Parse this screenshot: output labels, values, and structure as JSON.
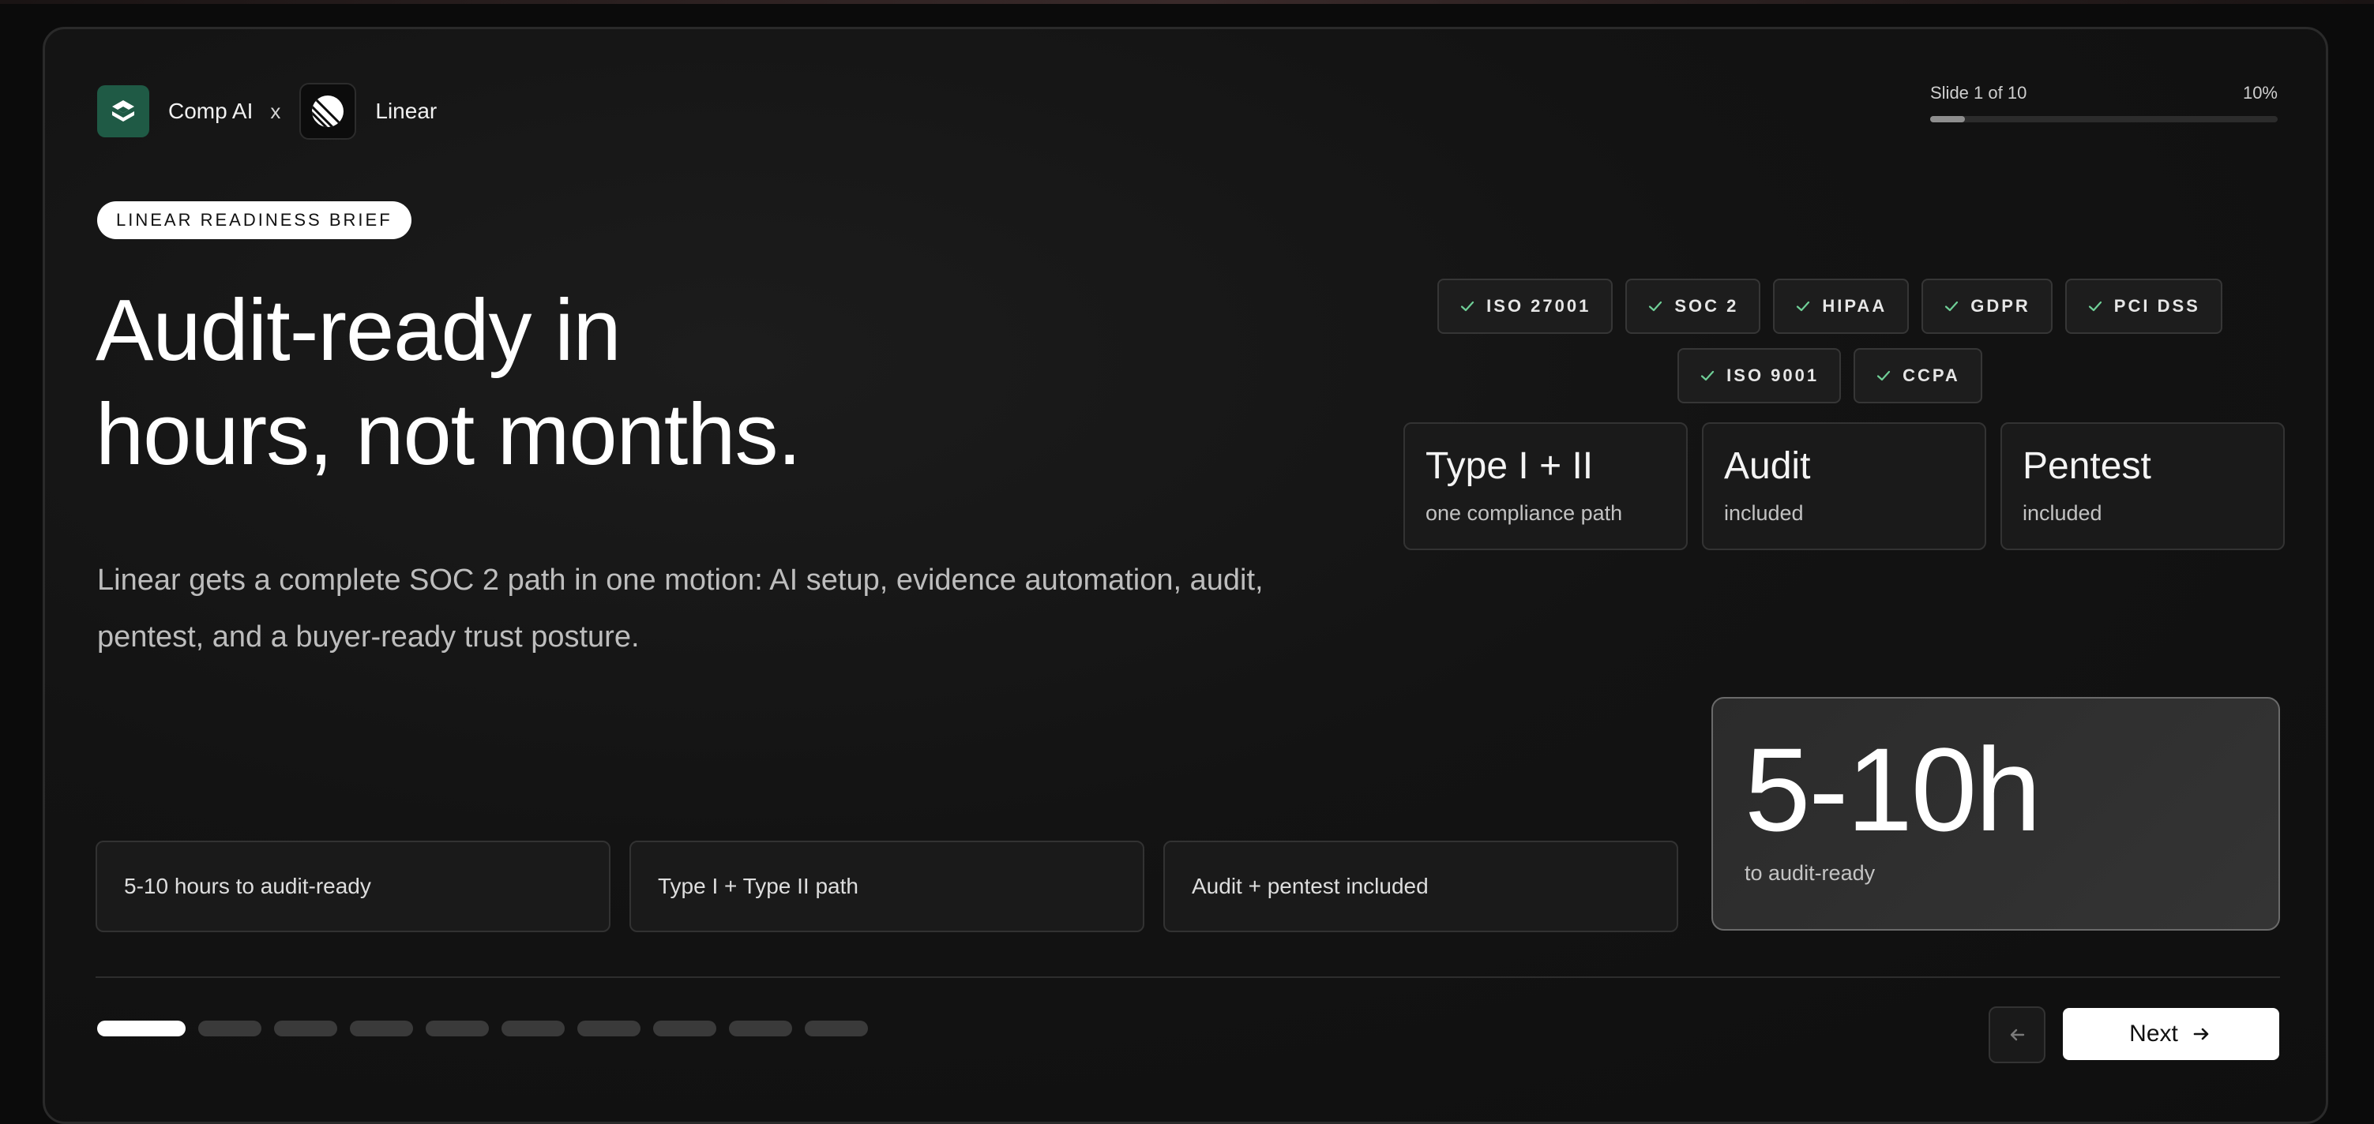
{
  "brand": {
    "partner_a": "Comp AI",
    "separator": "x",
    "partner_b": "Linear",
    "partner_a_icon": "comp-ai-logo-icon",
    "partner_b_icon": "linear-logo-icon",
    "accent": "#1f5a45"
  },
  "progress": {
    "label": "Slide 1 of 10",
    "percent_text": "10%",
    "fraction": 0.1
  },
  "hero": {
    "pill": "LINEAR READINESS BRIEF",
    "headline_line1": "Audit-ready in",
    "headline_line2": "hours, not months.",
    "lede": "Linear gets a complete SOC 2 path in one motion: AI setup, evidence automation, audit, pentest, and a buyer-ready trust posture."
  },
  "certifications": [
    {
      "label": "ISO 27001",
      "icon": "check-icon"
    },
    {
      "label": "SOC 2",
      "icon": "check-icon"
    },
    {
      "label": "HIPAA",
      "icon": "check-icon"
    },
    {
      "label": "GDPR",
      "icon": "check-icon"
    },
    {
      "label": "PCI DSS",
      "icon": "check-icon"
    },
    {
      "label": "ISO 9001",
      "icon": "check-icon"
    },
    {
      "label": "CCPA",
      "icon": "check-icon"
    }
  ],
  "check_color": "#6fcf97",
  "features": [
    {
      "title": "Type I + II",
      "subtitle": "one compliance path"
    },
    {
      "title": "Audit",
      "subtitle": "included"
    },
    {
      "title": "Pentest",
      "subtitle": "included"
    }
  ],
  "stat": {
    "value": "5-10h",
    "label": "to audit-ready"
  },
  "summaries": [
    "5-10 hours to audit-ready",
    "Type I + Type II path",
    "Audit + pentest included"
  ],
  "pager": {
    "total": 10,
    "current": 1
  },
  "nav": {
    "prev_icon": "arrow-left-icon",
    "next_label": "Next",
    "next_icon": "arrow-right-icon"
  }
}
